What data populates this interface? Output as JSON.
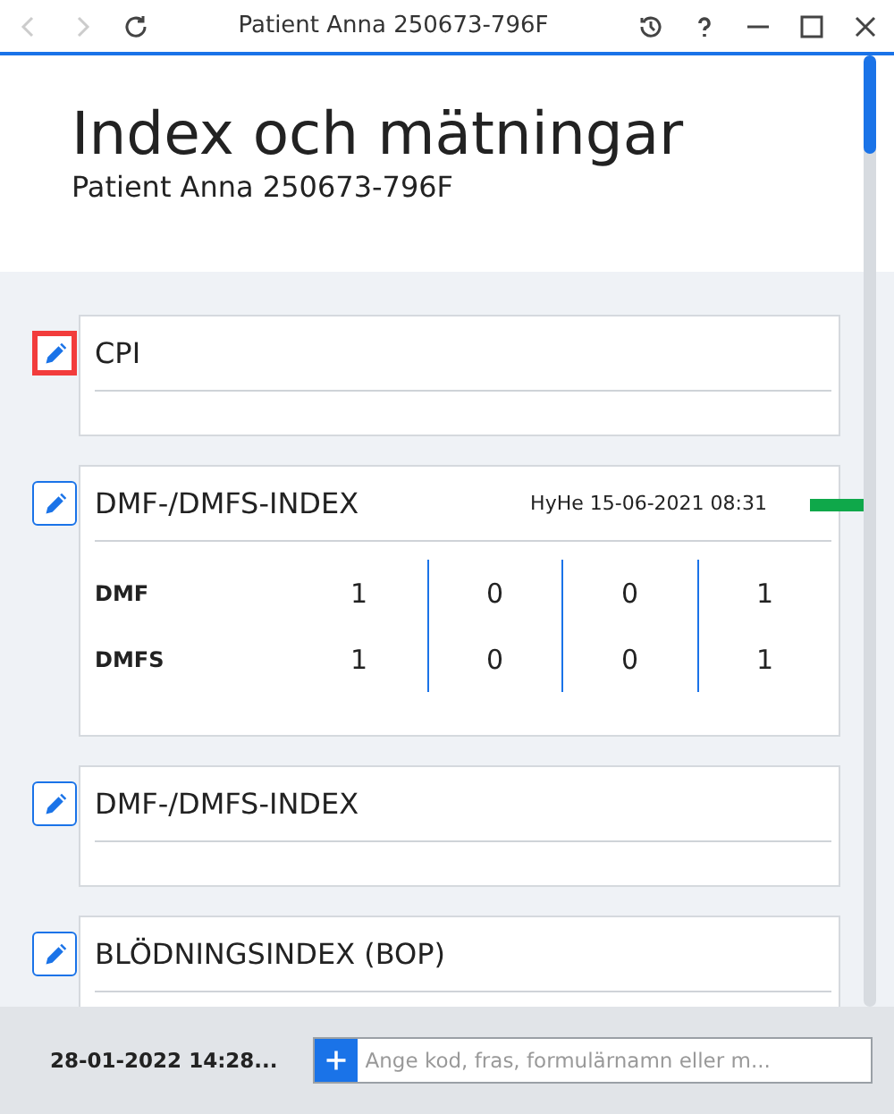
{
  "window": {
    "title": "Patient Anna 250673-796F"
  },
  "header": {
    "title": "Index och mätningar",
    "subtitle": "Patient Anna 250673-796F"
  },
  "cards": [
    {
      "kind": "empty",
      "title": "CPI",
      "highlighted": true
    },
    {
      "kind": "table",
      "title": "DMF-/DMFS-INDEX",
      "highlighted": false,
      "meta": "HyHe 15-06-2021 08:31",
      "color": "#0fa84a",
      "rows": [
        {
          "label": "DMF",
          "values": [
            "1",
            "0",
            "0",
            "1"
          ]
        },
        {
          "label": "DMFS",
          "values": [
            "1",
            "0",
            "0",
            "1"
          ]
        }
      ]
    },
    {
      "kind": "empty",
      "title": "DMF-/DMFS-INDEX",
      "highlighted": false
    },
    {
      "kind": "empty",
      "title": "BLÖDNINGSINDEX (BOP)",
      "highlighted": false
    }
  ],
  "footer": {
    "timestamp": "28-01-2022 14:28...",
    "input": {
      "placeholder": "Ange kod, fras, formulärnamn eller m..."
    }
  }
}
